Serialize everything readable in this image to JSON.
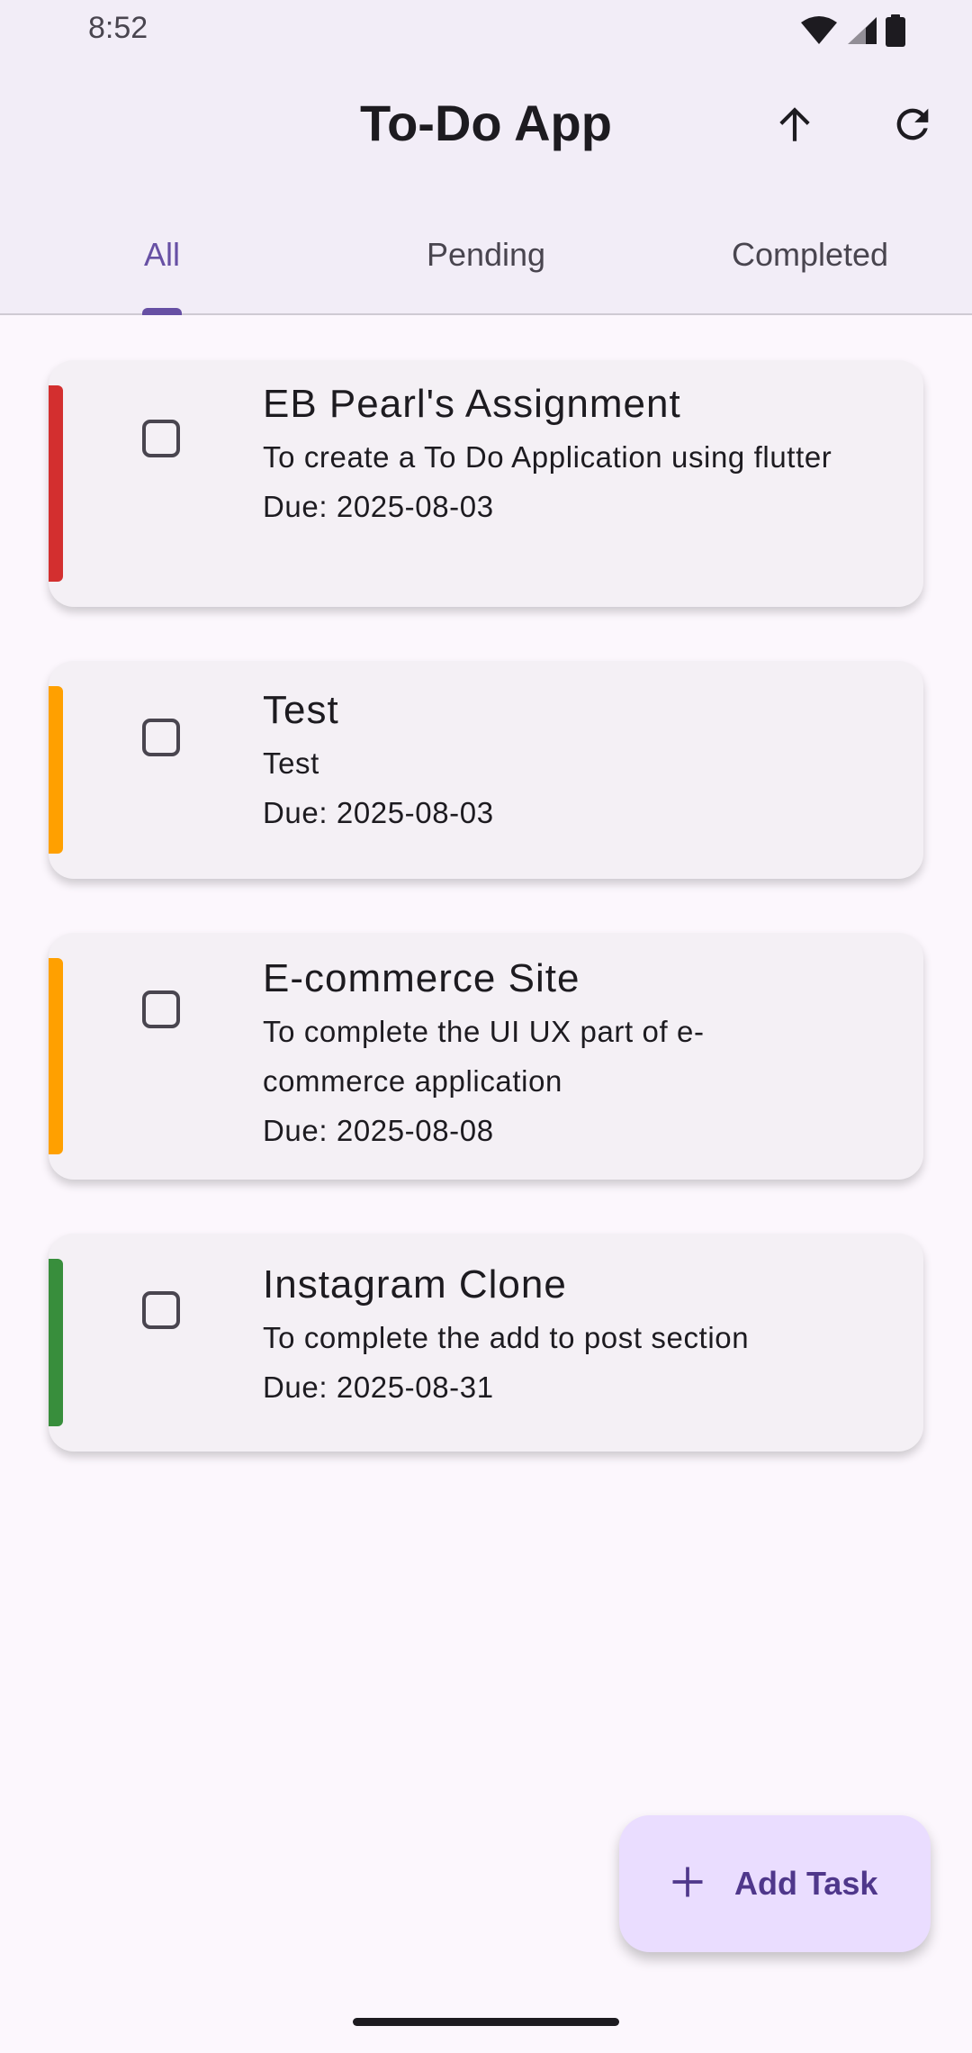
{
  "status_bar": {
    "time": "8:52"
  },
  "app_bar": {
    "title": "To-Do App",
    "actions": [
      "arrow-upward-icon",
      "refresh-icon"
    ]
  },
  "tabs": [
    {
      "label": "All",
      "active": true
    },
    {
      "label": "Pending",
      "active": false
    },
    {
      "label": "Completed",
      "active": false
    }
  ],
  "tasks": [
    {
      "title": "EB Pearl's Assignment",
      "description": "To create a To Do Application using flutter",
      "due": "Due: 2025-08-03",
      "priority_color": "#D32F2F",
      "checked": false
    },
    {
      "title": "Test",
      "description": "Test",
      "due": "Due: 2025-08-03",
      "priority_color": "#FFA000",
      "checked": false
    },
    {
      "title": "E-commerce Site",
      "description": "To complete the UI UX part of e-commerce application",
      "due": "Due: 2025-08-08",
      "priority_color": "#FFA000",
      "checked": false
    },
    {
      "title": "Instagram Clone",
      "description": "To complete the add to post section",
      "due": "Due: 2025-08-31",
      "priority_color": "#388E3C",
      "checked": false
    }
  ],
  "fab": {
    "label": "Add Task",
    "icon": "add-icon"
  },
  "colors": {
    "primary": "#6750A4",
    "appbar_bg": "#F2EDF7",
    "page_bg": "#FCF7FD",
    "card_bg": "#F4F0F5",
    "fab_bg": "#EADDFF"
  }
}
